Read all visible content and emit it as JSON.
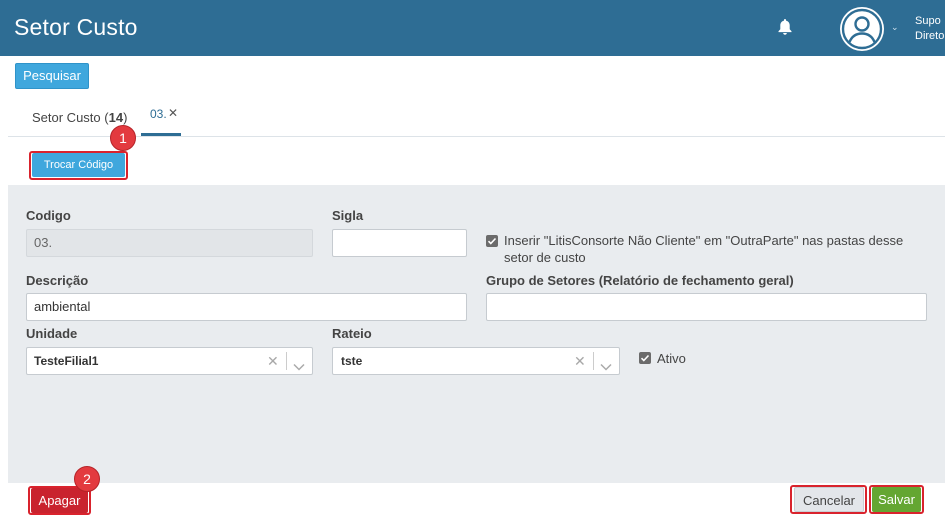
{
  "header": {
    "title": "Setor Custo",
    "user_name": "Supo",
    "user_role": "Direto",
    "bg_color": "#2e6d94"
  },
  "toolbar": {
    "search_label": "Pesquisar"
  },
  "tabs": [
    {
      "label": "Setor Custo (",
      "count": "14",
      "suffix": ")"
    },
    {
      "label": "03.",
      "close": "✕",
      "active": true
    }
  ],
  "actions": {
    "trocar_label": "Trocar Código"
  },
  "annotations": {
    "badge1": "1",
    "badge2": "2"
  },
  "form": {
    "codigo": {
      "label": "Codigo",
      "value": "03."
    },
    "sigla": {
      "label": "Sigla",
      "value": ""
    },
    "inserir_litis": {
      "text": "Inserir \"LitisConsorte Não Cliente\" em \"OutraParte\" nas pastas desse setor de custo",
      "checked": true
    },
    "descricao": {
      "label": "Descrição",
      "value": "ambiental"
    },
    "grupo": {
      "label": "Grupo de Setores (Relatório de fechamento geral)",
      "value": ""
    },
    "unidade": {
      "label": "Unidade",
      "value": "TesteFilial1"
    },
    "rateio": {
      "label": "Rateio",
      "value": "tste"
    },
    "ativo": {
      "label": "Ativo",
      "checked": true
    }
  },
  "footer": {
    "apagar_label": "Apagar",
    "cancelar_label": "Cancelar",
    "salvar_label": "Salvar"
  },
  "icons": [
    "bell-icon",
    "user-avatar-icon",
    "chevron-down-icon",
    "close-icon",
    "clear-icon",
    "checkbox-icon"
  ]
}
